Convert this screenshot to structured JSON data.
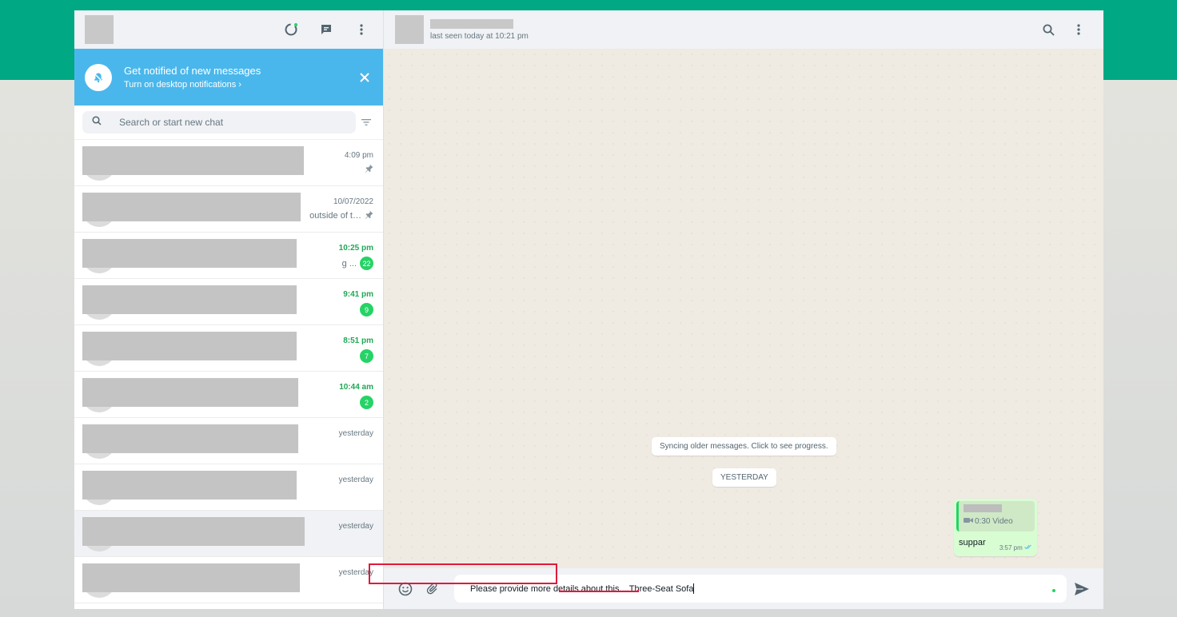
{
  "left": {
    "notify_title": "Get notified of new messages",
    "notify_sub": "Turn on desktop notifications ›",
    "search_placeholder": "Search or start new chat"
  },
  "chats": [
    {
      "time": "4:09 pm",
      "unread": false,
      "pinned": true,
      "badge": "",
      "snippet": "",
      "blur_w": 277
    },
    {
      "time": "10/07/2022",
      "unread": false,
      "pinned": true,
      "badge": "",
      "snippet": "outside of t…",
      "blur_w": 273
    },
    {
      "time": "10:25 pm",
      "unread": true,
      "pinned": false,
      "badge": "22",
      "snippet": "g ...",
      "blur_w": 268
    },
    {
      "time": "9:41 pm",
      "unread": true,
      "pinned": false,
      "badge": "9",
      "snippet": "",
      "blur_w": 268
    },
    {
      "time": "8:51 pm",
      "unread": true,
      "pinned": false,
      "badge": "7",
      "snippet": "",
      "blur_w": 268
    },
    {
      "time": "10:44 am",
      "unread": true,
      "pinned": false,
      "badge": "2",
      "snippet": "",
      "blur_w": 270
    },
    {
      "time": "yesterday",
      "unread": false,
      "pinned": false,
      "badge": "",
      "snippet": "",
      "blur_w": 270
    },
    {
      "time": "yesterday",
      "unread": false,
      "pinned": false,
      "badge": "",
      "snippet": "",
      "blur_w": 268
    },
    {
      "time": "yesterday",
      "unread": false,
      "pinned": false,
      "badge": "",
      "snippet": "",
      "blur_w": 278,
      "selected": true
    },
    {
      "time": "yesterday",
      "unread": false,
      "pinned": false,
      "badge": "",
      "snippet": "",
      "blur_w": 272
    }
  ],
  "conversation": {
    "last_seen": "last seen today at 10:21 pm",
    "sync_text": "Syncing older messages. Click to see progress.",
    "date_label": "YESTERDAY",
    "message": {
      "media_label": "0:30 Video",
      "text": "suppar",
      "time": "3:57 pm"
    }
  },
  "composer": {
    "prefix_text": "Please provide more details about this....",
    "typed_text": "Three-Seat Sofa"
  },
  "colors": {
    "brand": "#00a884",
    "banner": "#4ab7ec",
    "unread": "#1fa855",
    "highlight": "#e0193c"
  }
}
